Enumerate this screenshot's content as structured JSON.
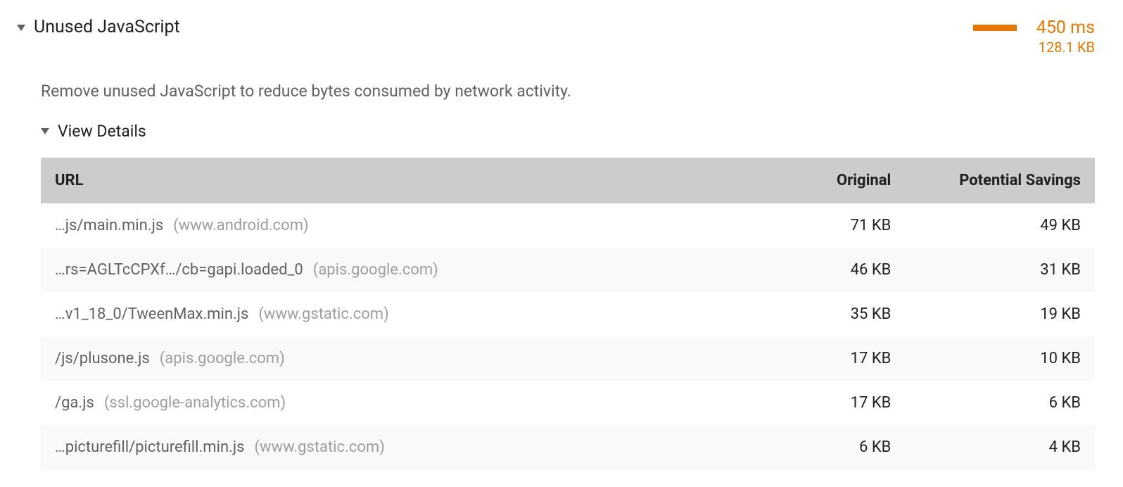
{
  "audit": {
    "title": "Unused JavaScript",
    "time_metric": "450 ms",
    "size_metric": "128.1 KB",
    "description": "Remove unused JavaScript to reduce bytes consumed by network activity.",
    "details_label": "View Details"
  },
  "table": {
    "headers": {
      "url": "URL",
      "original": "Original",
      "savings": "Potential Savings"
    },
    "rows": [
      {
        "path": "…js/main.min.js",
        "host": "(www.android.com)",
        "original": "71 KB",
        "savings": "49 KB"
      },
      {
        "path": "…rs=AGLTcCPXf…/cb=gapi.loaded_0",
        "host": "(apis.google.com)",
        "original": "46 KB",
        "savings": "31 KB"
      },
      {
        "path": "…v1_18_0/TweenMax.min.js",
        "host": "(www.gstatic.com)",
        "original": "35 KB",
        "savings": "19 KB"
      },
      {
        "path": "/js/plusone.js",
        "host": "(apis.google.com)",
        "original": "17 KB",
        "savings": "10 KB"
      },
      {
        "path": "/ga.js",
        "host": "(ssl.google-analytics.com)",
        "original": "17 KB",
        "savings": "6 KB"
      },
      {
        "path": "…picturefill/picturefill.min.js",
        "host": "(www.gstatic.com)",
        "original": "6 KB",
        "savings": "4 KB"
      }
    ]
  }
}
